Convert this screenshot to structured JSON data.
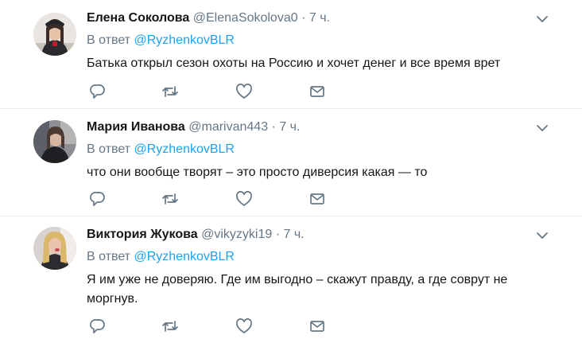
{
  "tweets": [
    {
      "name": "Елена Соколова",
      "handle": "@ElenaSokolova0",
      "dot": "·",
      "time": "7 ч.",
      "reply_prefix": "В ответ",
      "reply_to": "@RyzhenkovBLR",
      "text": "Батька открыл сезон охоты на Россию и хочет денег и все время врет"
    },
    {
      "name": "Мария Иванова",
      "handle": "@marivan443",
      "dot": "·",
      "time": "7 ч.",
      "reply_prefix": "В ответ",
      "reply_to": "@RyzhenkovBLR",
      "text": "что они вообще творят – это просто диверсия какая — то"
    },
    {
      "name": "Виктория Жукова",
      "handle": "@vikyzyki19",
      "dot": "·",
      "time": "7 ч.",
      "reply_prefix": "В ответ",
      "reply_to": "@RyzhenkovBLR",
      "text": "Я им уже не доверяю. Где им выгодно – скажут правду, а  где соврут не моргнув."
    }
  ],
  "icons": {
    "reply": "reply-icon",
    "retweet": "retweet-icon",
    "like": "heart-icon",
    "dm": "envelope-icon",
    "caret": "chevron-down-icon"
  },
  "colors": {
    "text": "#14171a",
    "muted": "#657786",
    "link": "#1da1f2",
    "divider": "#e6ecf0"
  }
}
